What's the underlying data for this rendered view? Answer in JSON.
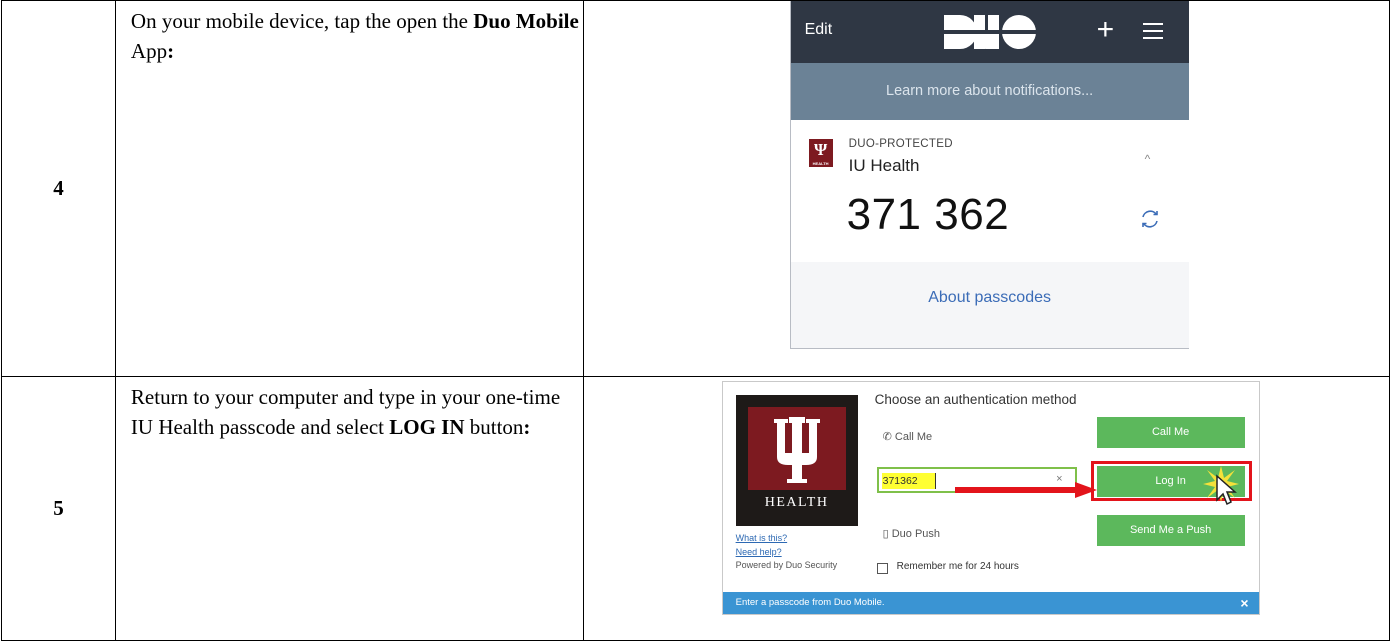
{
  "steps": [
    {
      "number": "4",
      "text_before": "On your mobile device, tap the open the ",
      "text_bold": "Duo Mobile",
      "text_middle": " App",
      "text_bold_end": ":"
    },
    {
      "number": "5",
      "text_before": "Return to your computer and type in your one-time IU Health passcode and select ",
      "text_bold": "LOG IN",
      "text_middle": " button",
      "text_bold_end": ":"
    }
  ],
  "mobile_app": {
    "edit_label": "Edit",
    "logo_icon": "duo-logo-icon",
    "add_icon": "+",
    "menu_icon": "hamburger-icon",
    "notification_banner": "Learn more about notifications...",
    "account_badge": "ΨHEALTH",
    "account_label": "DUO-PROTECTED",
    "account_name": "IU Health",
    "caret": "^",
    "passcode": "371 362",
    "refresh_icon": "refresh-icon",
    "about_link": "About passcodes",
    "colors": {
      "header": "#2f3744",
      "banner": "#6b8296",
      "link": "#3b6cb7",
      "iu_red": "#7d1a20"
    }
  },
  "duo_prompt": {
    "logo_text": "HEALTH",
    "title": "Choose an authentication method",
    "what_is_this": "What is this?",
    "need_help": "Need help?",
    "powered_by": "Powered by Duo Security",
    "call_label": "Call Me",
    "call_button": "Call Me",
    "passcode_value": "371362",
    "clear_icon": "×",
    "login_button": "Log In",
    "push_label": "Duo Push",
    "push_button": "Send Me a Push",
    "remember_label": "Remember me for 24 hours",
    "footer_message": "Enter a passcode from Duo Mobile.",
    "footer_close": "×",
    "colors": {
      "button": "#5cb85c",
      "footer": "#3a94d3",
      "highlight_box": "#e3141b",
      "passcode_highlight": "#ffff33"
    }
  }
}
